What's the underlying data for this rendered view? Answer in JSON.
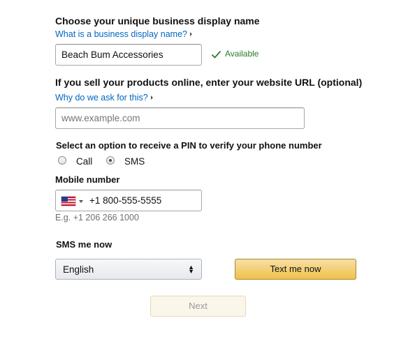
{
  "display_name": {
    "heading": "Choose your unique business display name",
    "help_link": "What is a business display name?",
    "value": "Beach Bum Accessories",
    "status": "Available"
  },
  "website": {
    "heading": "If you sell your products online, enter your website URL (optional)",
    "help_link": "Why do we ask for this?",
    "placeholder": "www.example.com"
  },
  "pin": {
    "heading": "Select an option to receive a PIN to verify your phone number",
    "options": [
      {
        "label": "Call",
        "selected": false
      },
      {
        "label": "SMS",
        "selected": true
      }
    ]
  },
  "mobile": {
    "heading": "Mobile number",
    "country": "US",
    "value": "+1 800-555-5555",
    "hint": "E.g. +1 206 266 1000"
  },
  "sms": {
    "heading": "SMS me now",
    "language": "English",
    "button_label": "Text me now"
  },
  "next_button": "Next",
  "colors": {
    "link": "#0066c0",
    "available": "#2a7a2a",
    "primary_button": "#f0c14b"
  }
}
